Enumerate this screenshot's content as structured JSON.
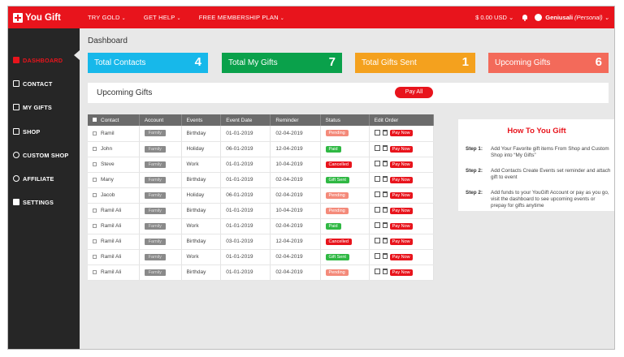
{
  "header": {
    "logo_text": "You Gift",
    "nav": [
      {
        "label": "TRY GOLD",
        "caret": "⌄"
      },
      {
        "label": "GET HELP",
        "caret": "⌄"
      },
      {
        "label": "FREE MEMBERSHIP PLAN",
        "caret": "⌄"
      }
    ],
    "balance": "$ 0.00 USD ⌄",
    "user_name": "Geniusali",
    "user_type": "(Personal) ⌄"
  },
  "sidebar": {
    "items": [
      {
        "label": "DASHBOARD",
        "icon": "dashboard-icon"
      },
      {
        "label": "CONTACT",
        "icon": "contact-icon"
      },
      {
        "label": "MY GIFTS",
        "icon": "gift-icon"
      },
      {
        "label": "SHOP",
        "icon": "cart-icon"
      },
      {
        "label": "CUSTOM SHOP",
        "icon": "custom-shop-icon"
      },
      {
        "label": "AFFILIATE",
        "icon": "affiliate-icon"
      },
      {
        "label": "SETTINGS",
        "icon": "settings-icon"
      }
    ]
  },
  "main": {
    "title": "Dashboard",
    "cards": [
      {
        "label": "Total Contacts",
        "value": "4",
        "color": "#17b8ea"
      },
      {
        "label": "Total My Gifts",
        "value": "7",
        "color": "#0aa14b"
      },
      {
        "label": "Total Gifts Sent",
        "value": "1",
        "color": "#f4a11e"
      },
      {
        "label": "Upcoming Gifts",
        "value": "6",
        "color": "#f36a5a"
      }
    ],
    "upcoming_title": "Upcoming Gifts",
    "pay_all": "Pay All"
  },
  "table": {
    "headers": [
      "Contact",
      "Account",
      "Events",
      "Event Date",
      "Reminder",
      "Status",
      "Edit Order"
    ],
    "pay_now": "Pay Now",
    "rows": [
      {
        "contact": "Ramil",
        "account": "Family",
        "event": "Birthday",
        "date": "01-01-2019",
        "reminder": "02-04-2019",
        "status": "Pending",
        "st": "pending"
      },
      {
        "contact": "John",
        "account": "Family",
        "event": "Holiday",
        "date": "06-01-2019",
        "reminder": "12-04-2019",
        "status": "Paid",
        "st": "paid"
      },
      {
        "contact": "Steve",
        "account": "Family",
        "event": "Work",
        "date": "01-01-2019",
        "reminder": "10-04-2019",
        "status": "Cancelled",
        "st": "cancelled"
      },
      {
        "contact": "Many",
        "account": "Family",
        "event": "Birthday",
        "date": "01-01-2019",
        "reminder": "02-04-2019",
        "status": "Gift Sent",
        "st": "giftsent"
      },
      {
        "contact": "Jacob",
        "account": "Family",
        "event": "Holiday",
        "date": "06-01-2019",
        "reminder": "02-04-2019",
        "status": "Pending",
        "st": "pending"
      },
      {
        "contact": "Ramil Ali",
        "account": "Family",
        "event": "Birthday",
        "date": "01-01-2019",
        "reminder": "10-04-2019",
        "status": "Pending",
        "st": "pending"
      },
      {
        "contact": "Ramil Ali",
        "account": "Family",
        "event": "Work",
        "date": "01-01-2019",
        "reminder": "02-04-2019",
        "status": "Paid",
        "st": "paid"
      },
      {
        "contact": "Ramil Ali",
        "account": "Family",
        "event": "Birthday",
        "date": "03-01-2019",
        "reminder": "12-04-2019",
        "status": "Cancelled",
        "st": "cancelled"
      },
      {
        "contact": "Ramil Ali",
        "account": "Family",
        "event": "Work",
        "date": "01-01-2019",
        "reminder": "02-04-2019",
        "status": "Gift Sent",
        "st": "giftsent"
      },
      {
        "contact": "Ramil Ali",
        "account": "Family",
        "event": "Birthday",
        "date": "01-01-2019",
        "reminder": "02-04-2019",
        "status": "Pending",
        "st": "pending"
      }
    ]
  },
  "howto": {
    "title": "How To You Gift",
    "steps": [
      {
        "label": "Step 1:",
        "text": "Add Your Favorite gift items From Shop and Custom Shop into “My Gifts”"
      },
      {
        "label": "Step 2:",
        "text": "Add Contacts Create Events set reminder and attach gift to event"
      },
      {
        "label": "Step 2:",
        "text": "Add funds to your YouGift Account or pay as you go, visit the dashboard to see upcoming events or prepay for gifts anytime"
      }
    ]
  },
  "colors": {
    "brand": "#e8141c",
    "sidebar": "#262626"
  }
}
